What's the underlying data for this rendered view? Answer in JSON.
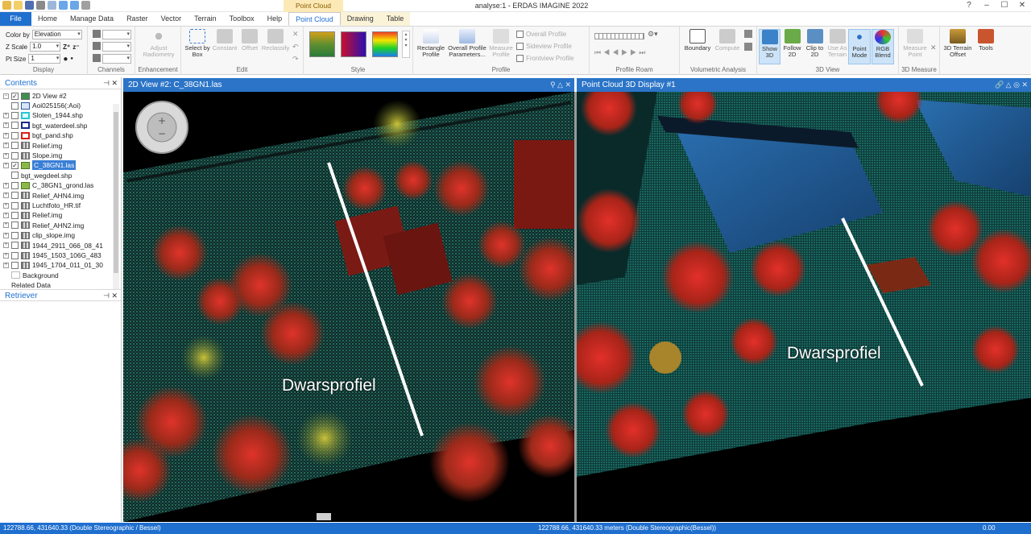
{
  "titlebar": {
    "context_tab": "Point Cloud",
    "app_title": "analyse:1 - ERDAS IMAGINE 2022",
    "controls": [
      "?",
      "–",
      "☐",
      "✕"
    ]
  },
  "tabs": [
    {
      "label": "File"
    },
    {
      "label": "Home"
    },
    {
      "label": "Manage Data"
    },
    {
      "label": "Raster"
    },
    {
      "label": "Vector"
    },
    {
      "label": "Terrain"
    },
    {
      "label": "Toolbox"
    },
    {
      "label": "Help"
    },
    {
      "label": "Point Cloud"
    },
    {
      "label": "Drawing"
    },
    {
      "label": "Table"
    }
  ],
  "ribbon": {
    "display": {
      "label": "Display",
      "color_by_label": "Color by",
      "color_by_value": "Elevation",
      "zscale_label": "Z Scale",
      "zscale_value": "1.0",
      "ptsize_label": "Pt Size",
      "ptsize_value": "1"
    },
    "channels": {
      "label": "Channels"
    },
    "enhancement": {
      "label": "Enhancement",
      "adjust": "Adjust Radiometry"
    },
    "edit": {
      "label": "Edit",
      "select": "Select by Box",
      "constant": "Constant",
      "offset": "Offset",
      "reclassify": "Reclassify"
    },
    "style": {
      "label": "Style"
    },
    "profile": {
      "label": "Profile",
      "rectangle": "Rectangle Profile",
      "overall_params": "Overall Profile Parameters...",
      "measure": "Measure Profile",
      "overall": "Overall Profile",
      "sideview": "Sideview Profile",
      "frontview": "Frontview Profile"
    },
    "roam": {
      "label": "Profile Roam"
    },
    "volumetric": {
      "label": "Volumetric Analysis",
      "boundary": "Boundary",
      "compute": "Compute"
    },
    "view3d": {
      "label": "3D View",
      "show3d": "Show 3D",
      "follow2d": "Follow 2D",
      "clip2d": "Clip to 2D",
      "terrain": "Use As Terrain",
      "pointmode": "Point Mode",
      "rgb": "RGB Blend"
    },
    "measure3d": {
      "label": "3D Measure",
      "point": "Measure Point"
    },
    "terrain_offset": "3D Terrain Offset",
    "tools": "Tools"
  },
  "contents": {
    "title": "Contents",
    "root": "2D View #2",
    "layers": [
      {
        "name": "Aoi025156(:Aoi)",
        "icon": "aoi",
        "checked": false,
        "expander": false
      },
      {
        "name": "Sloten_1944.shp",
        "icon": "shp-cyan",
        "checked": false,
        "expander": true
      },
      {
        "name": "bgt_waterdeel.shp",
        "icon": "shp-navy",
        "checked": false,
        "expander": true
      },
      {
        "name": "bgt_pand.shp",
        "icon": "shp-red",
        "checked": false,
        "expander": true
      },
      {
        "name": "Relief.img",
        "icon": "img",
        "checked": false,
        "expander": true
      },
      {
        "name": "Slope.img",
        "icon": "img",
        "checked": false,
        "expander": true
      },
      {
        "name": "C_38GN1.las",
        "icon": "las",
        "checked": true,
        "expander": true,
        "selected": true
      },
      {
        "name": "bgt_wegdeel.shp",
        "icon": "none",
        "checked": false,
        "expander": false
      },
      {
        "name": "C_38GN1_grond.las",
        "icon": "las",
        "checked": false,
        "expander": true
      },
      {
        "name": "Relief_AHN4.img",
        "icon": "img",
        "checked": false,
        "expander": true
      },
      {
        "name": "Luchtfoto_HR.tif",
        "icon": "img",
        "checked": false,
        "expander": true
      },
      {
        "name": "Relief.img",
        "icon": "img",
        "checked": false,
        "expander": true
      },
      {
        "name": "Relief_AHN2.img",
        "icon": "img",
        "checked": false,
        "expander": true
      },
      {
        "name": "clip_slope.img",
        "icon": "img",
        "checked": false,
        "expander": true
      },
      {
        "name": "1944_2911_066_08_41",
        "icon": "img",
        "checked": false,
        "expander": true
      },
      {
        "name": "1945_1503_106G_483",
        "icon": "img",
        "checked": false,
        "expander": true
      },
      {
        "name": "1945_1704_011_01_30",
        "icon": "img",
        "checked": false,
        "expander": true
      },
      {
        "name": "Background",
        "icon": "bg",
        "checked": false,
        "expander": false
      }
    ],
    "related": "Related Data"
  },
  "retriever": {
    "title": "Retriever"
  },
  "view2d": {
    "title": "2D View #2: C_38GN1.las",
    "annotation": "Dwarsprofiel"
  },
  "view3d": {
    "title": "Point Cloud 3D Display #1",
    "annotation": "Dwarsprofiel"
  },
  "status": {
    "left": "122788.66, 431640.33  (Double Stereographic / Bessel)",
    "center": "122788.66, 431640.33 meters (Double Stereographic(Bessel))",
    "right": "0.00"
  },
  "colors": {
    "accent": "#1f6fcf",
    "header": "#2b74c7",
    "lidar_green": "#1f7a5a",
    "lidar_red": "#c8261e",
    "lidar_blue": "#1d4f8c"
  }
}
